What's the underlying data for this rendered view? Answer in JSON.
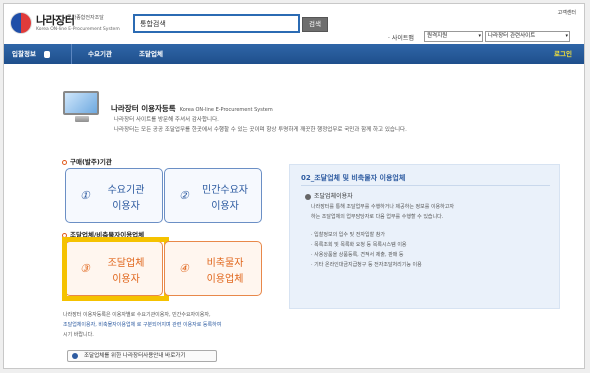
{
  "header": {
    "logo_name": "나라장터",
    "logo_sub": "국가종합전자조달",
    "logo_eng": "Korea ON-line E-Procurement System",
    "search_value": "통합검색",
    "search_button": "검색",
    "help_link": "고객센터",
    "sitemap_label": "· 사이트맵",
    "support_select": "원격지원",
    "related_select": "나라장터 관련사이트"
  },
  "nav": {
    "items": [
      "입찰정보",
      "수요기관",
      "조달업체"
    ],
    "login": "로그인"
  },
  "registration": {
    "title": "나라장터 이용자등록",
    "title_eng": "Korea ON-line E-Procurement System",
    "welcome_line1": "나라장터 사이트를 방문해 주셔서 감사합니다.",
    "welcome_line2": "나라장터는 모든 공공 조달업무를 한곳에서 수행할 수 있는 곳이며 항상 투명하게 깨끗한 행정업무로 국민과 함께 하고 있습니다."
  },
  "buyer_section": {
    "label": "구매(발주)기관",
    "cards": [
      {
        "number": "①",
        "line1": "수요기관",
        "line2": "이용자"
      },
      {
        "number": "②",
        "line1": "민간수요자",
        "line2": "이용자"
      }
    ]
  },
  "vendor_section": {
    "label": "조달업체/비축물자이용업체",
    "cards": [
      {
        "number": "③",
        "line1": "조달업체",
        "line2": "이용자"
      },
      {
        "number": "④",
        "line1": "비축물자",
        "line2": "이용업체"
      }
    ]
  },
  "notice": {
    "line1": "나라장터 이용자등록은 이용자별로 수요기관이용자, 민간수요자이용자,",
    "line2": "조달업체이용자, 비축물자이용업체 로 구분되어지며 관련 이용자로 등록하여",
    "line3": "시기 바랍니다.",
    "guide_button": "조달업체를 위한 나라장터사용안내 바로가기"
  },
  "info_panel": {
    "title": "02_조달업체 및 비축물자 이용업체",
    "subtitle": "조달업체이용자",
    "text1": "나라장터를 통해 조달업무를 수행하거나 제공하는 정보를 이용하고자",
    "text2": "하는 조달업체의 업무담당자로 다음 업무를 수행할 수 있습니다.",
    "bullets": [
      "· 입찰정보의 입수 및 전자입찰 참가",
      "· 목록조회 및 목록화 요청 등 목록시스템 이용",
      "· 사용상품을 상품등록, 견적서 제출, 판매 등",
      "· 기타 온라인대금지급청구 등 전자조달처리기능 이용"
    ]
  },
  "colors": {
    "nav_blue": "#1f4f8c",
    "buyer_blue": "#2c5aa0",
    "vendor_orange": "#e0661c",
    "highlight_yellow": "#f5c200",
    "login_yellow": "#f4e23a"
  }
}
